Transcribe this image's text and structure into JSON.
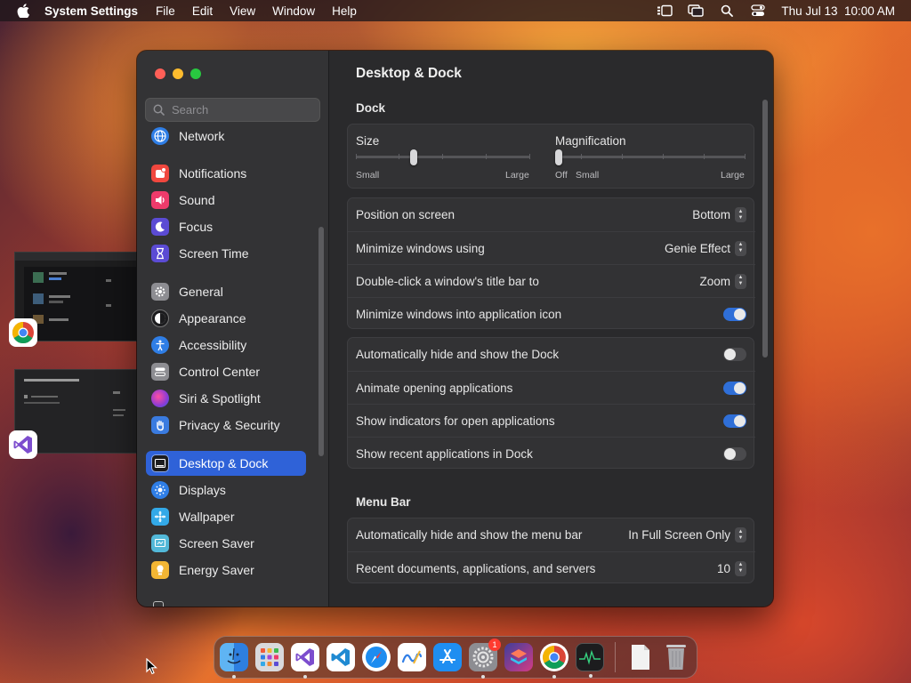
{
  "menubar": {
    "app_name": "System Settings",
    "items": [
      "File",
      "Edit",
      "View",
      "Window",
      "Help"
    ],
    "datetime": "Thu Jul 13  10:00 AM"
  },
  "sidebar": {
    "search_placeholder": "Search",
    "items": [
      {
        "label": "Network",
        "icon": "network-icon",
        "color": "#2f7ee6"
      },
      {
        "label": "Notifications",
        "icon": "notifications-icon",
        "color": "#f0473e"
      },
      {
        "label": "Sound",
        "icon": "sound-icon",
        "color": "#ee3b6b"
      },
      {
        "label": "Focus",
        "icon": "focus-icon",
        "color": "#5b4bd4"
      },
      {
        "label": "Screen Time",
        "icon": "screen-time-icon",
        "color": "#5b4bd4"
      },
      {
        "label": "General",
        "icon": "gear-icon",
        "color": "#8d8d92"
      },
      {
        "label": "Appearance",
        "icon": "appearance-icon",
        "color": "#1c1c1e"
      },
      {
        "label": "Accessibility",
        "icon": "accessibility-icon",
        "color": "#2f7ee6"
      },
      {
        "label": "Control Center",
        "icon": "control-center-icon",
        "color": "#8d8d92"
      },
      {
        "label": "Siri & Spotlight",
        "icon": "siri-icon",
        "color": "#b43cc9"
      },
      {
        "label": "Privacy & Security",
        "icon": "hand-icon",
        "color": "#3a7be0"
      },
      {
        "label": "Desktop & Dock",
        "icon": "desktop-dock-icon",
        "color": "#1c1c1e"
      },
      {
        "label": "Displays",
        "icon": "displays-icon",
        "color": "#2f7ee6"
      },
      {
        "label": "Wallpaper",
        "icon": "wallpaper-icon",
        "color": "#33a9e8"
      },
      {
        "label": "Screen Saver",
        "icon": "screen-saver-icon",
        "color": "#52b8d8"
      },
      {
        "label": "Energy Saver",
        "icon": "energy-saver-icon",
        "color": "#f3b634"
      }
    ],
    "selected": "Desktop & Dock"
  },
  "content": {
    "title": "Desktop & Dock",
    "dock_section": "Dock",
    "size": {
      "label": "Size",
      "min_label": "Small",
      "max_label": "Large",
      "value": 0.2
    },
    "magnification": {
      "label": "Magnification",
      "off_label": "Off",
      "min_label": "Small",
      "max_label": "Large",
      "value": 0.0
    },
    "position_rows": [
      {
        "label": "Position on screen",
        "value": "Bottom",
        "type": "popup"
      },
      {
        "label": "Minimize windows using",
        "value": "Genie Effect",
        "type": "popup"
      },
      {
        "label": "Double-click a window's title bar to",
        "value": "Zoom",
        "type": "popup"
      },
      {
        "label": "Minimize windows into application icon",
        "on": true,
        "type": "toggle"
      }
    ],
    "behaviour_rows": [
      {
        "label": "Automatically hide and show the Dock",
        "on": false
      },
      {
        "label": "Animate opening applications",
        "on": true
      },
      {
        "label": "Show indicators for open applications",
        "on": true
      },
      {
        "label": "Show recent applications in Dock",
        "on": false
      }
    ],
    "menubar_section": "Menu Bar",
    "menubar_rows": [
      {
        "label": "Automatically hide and show the menu bar",
        "value": "In Full Screen Only"
      },
      {
        "label": "Recent documents, applications, and servers",
        "value": "10"
      }
    ]
  },
  "dock": {
    "badge_count": "1",
    "apps": [
      "finder-icon",
      "launchpad-icon",
      "visual-studio-icon",
      "vscode-icon",
      "safari-icon",
      "freeform-icon",
      "app-store-icon",
      "system-settings-icon",
      "shortcuts-icon",
      "chrome-icon",
      "activity-monitor-icon",
      "document-icon",
      "trash-icon"
    ]
  },
  "colors": {
    "accent": "#2f62d8",
    "toggle_on": "#2f6fd8"
  }
}
